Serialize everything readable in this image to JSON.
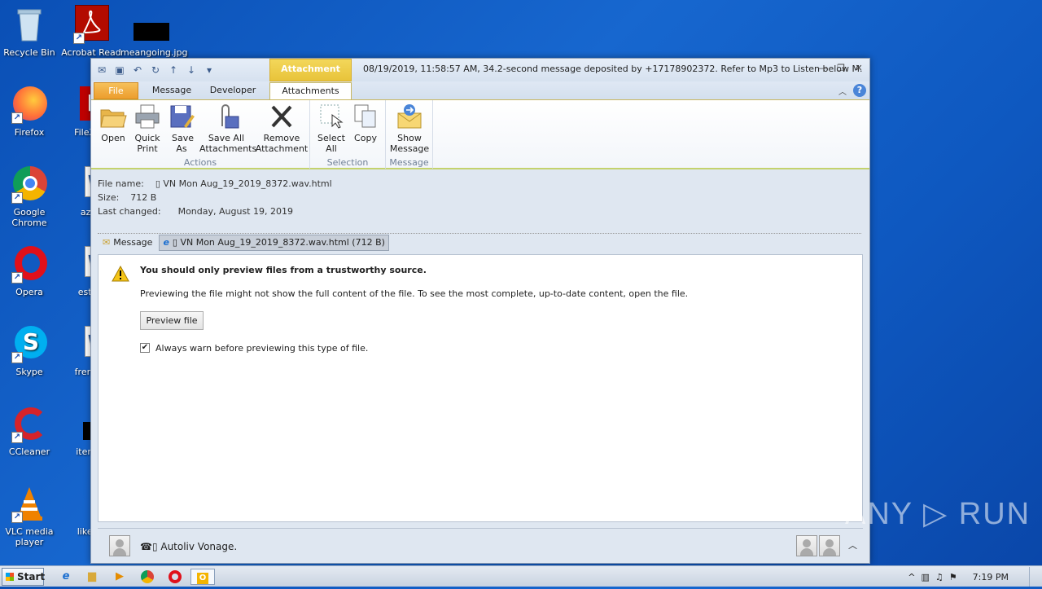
{
  "desktop": {
    "icons": [
      {
        "label": "Recycle Bin"
      },
      {
        "label": "Acrobat Read"
      },
      {
        "label": "meangoing.jpg"
      },
      {
        "label": "Firefox"
      },
      {
        "label": "FileZilla"
      },
      {
        "label": "Google Chrome"
      },
      {
        "label": "azag"
      },
      {
        "label": "Opera"
      },
      {
        "label": "estwa"
      },
      {
        "label": "Skype"
      },
      {
        "label": "frenchs"
      },
      {
        "label": "CCleaner"
      },
      {
        "label": "itemsb"
      },
      {
        "label": "VLC media player"
      },
      {
        "label": "likelyc"
      }
    ]
  },
  "window": {
    "context_tab": "Attachment Tools",
    "title": "08/19/2019, 11:58:57 AM, 34.2-second message deposited by +17178902372. Refer to Mp3 to Listen below M.",
    "tabs": {
      "file": "File",
      "message": "Message",
      "developer": "Developer",
      "attachments": "Attachments"
    }
  },
  "ribbon": {
    "open": "Open",
    "quick_print": "Quick Print",
    "save_as": "Save As",
    "save_all": "Save All Attachments",
    "remove": "Remove Attachment",
    "actions_group": "Actions",
    "select_all": "Select All",
    "copy": "Copy",
    "selection_group": "Selection",
    "show_message": "Show Message",
    "message_group": "Message"
  },
  "attachment_info": {
    "file_name_label": "File name:",
    "file_name": "▯ VN Mon Aug_19_2019_8372.wav.html",
    "size_label": "Size:",
    "size": "712 B",
    "changed_label": "Last changed:",
    "changed": "Monday, August 19, 2019"
  },
  "attachment_bar": {
    "message": "Message",
    "attachment": "▯ VN Mon Aug_19_2019_8372.wav.html (712 B)"
  },
  "preview": {
    "warning_title": "You should only preview files from a trustworthy source.",
    "warning_text": "Previewing the file might not show the full content of the file. To see the most complete, up-to-date content, open the file.",
    "preview_button": "Preview file",
    "always_warn_label": "Always warn before previewing this type of file.",
    "always_warn_checked": true
  },
  "people_pane": {
    "sender": "☎▯ Autoliv Vonage."
  },
  "watermark": "ANY ▷ RUN",
  "taskbar": {
    "start": "Start",
    "clock": "7:19 PM"
  },
  "colors": {
    "desktop": "#1767cf",
    "file_tab": "#ec9d2d",
    "context_tab": "#e8c33a",
    "ribbon_accent": "#c4d26d"
  }
}
